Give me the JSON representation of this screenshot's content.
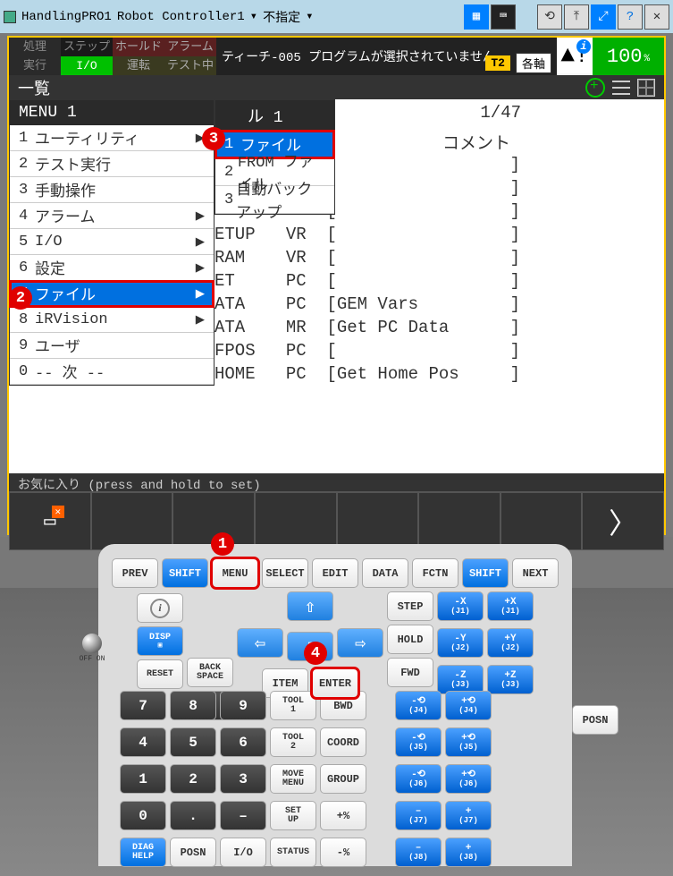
{
  "titlebar": {
    "app": "HandlingPRO1",
    "controller": "Robot Controller1",
    "mode": "不指定"
  },
  "status": {
    "row1": [
      "処理",
      "ステップ",
      "ホールド",
      "アラーム"
    ],
    "row2": [
      "実行",
      "I/O",
      "運転",
      "テスト中"
    ],
    "message": "ティーチ-005 プログラムが選択されていません",
    "t2": "T2",
    "axis": "各軸",
    "value": "100",
    "pct": "%"
  },
  "header": "一覧",
  "content": {
    "page": "1/47",
    "comment_label": "コメント",
    "bg_rows": [
      {
        "a": "",
        "b": "",
        "c": "[",
        "d": "]"
      },
      {
        "a": "",
        "b": "",
        "c": "[",
        "d": "]"
      },
      {
        "a": "",
        "b": "",
        "c": "[",
        "d": "]"
      },
      {
        "a": "ETUP",
        "b": "VR",
        "c": "[",
        "d": "]"
      },
      {
        "a": "RAM",
        "b": "VR",
        "c": "[",
        "d": "]"
      },
      {
        "a": "ET",
        "b": "PC",
        "c": "[",
        "d": "]"
      },
      {
        "a": "ATA",
        "b": "PC",
        "c": "[GEM Vars",
        "d": "]"
      },
      {
        "a": "ATA",
        "b": "MR",
        "c": "[Get PC Data",
        "d": "]"
      },
      {
        "a": "FPOS",
        "b": "PC",
        "c": "[",
        "d": "]"
      },
      {
        "a": "HOME",
        "b": "PC",
        "c": "[Get Home Pos",
        "d": "]"
      }
    ]
  },
  "menu": {
    "title": "MENU  1",
    "items": [
      {
        "n": "1",
        "label": "ユーティリティ",
        "arrow": true
      },
      {
        "n": "2",
        "label": "テスト実行",
        "arrow": false
      },
      {
        "n": "3",
        "label": "手動操作",
        "arrow": false
      },
      {
        "n": "4",
        "label": "アラーム",
        "arrow": true
      },
      {
        "n": "5",
        "label": "I/O",
        "arrow": true
      },
      {
        "n": "6",
        "label": "設定",
        "arrow": true
      },
      {
        "n": "7",
        "label": "ファイル",
        "arrow": true,
        "sel": true,
        "red": true
      },
      {
        "n": "8",
        "label": "iRVision",
        "arrow": true
      },
      {
        "n": "9",
        "label": "ユーザ",
        "arrow": false
      },
      {
        "n": "0",
        "label": "--  次  --",
        "arrow": false
      }
    ]
  },
  "submenu": {
    "title": "ル  1",
    "items": [
      {
        "n": "1",
        "label": "ファイル",
        "sel": true,
        "red": true
      },
      {
        "n": "2",
        "label": "FROM ファイル"
      },
      {
        "n": "3",
        "label": "自動バックアップ"
      }
    ]
  },
  "fav": {
    "hint": "お気に入り (press and hold to set)"
  },
  "keys": {
    "row1": [
      "PREV",
      "SHIFT",
      "MENU",
      "SELECT",
      "EDIT",
      "DATA",
      "FCTN",
      "SHIFT",
      "NEXT"
    ],
    "step": "STEP",
    "hold": "HOLD",
    "fwd": "FWD",
    "bwd": "BWD",
    "coord": "COORD",
    "group": "GROUP",
    "disp": "DISP",
    "reset": "RESET",
    "backspace": "BACK\nSPACE",
    "item": "ITEM",
    "enter": "ENTER",
    "tool1": "TOOL\n1",
    "tool2": "TOOL\n2",
    "movemenu": "MOVE\nMENU",
    "setup": "SET\nUP",
    "diag": "DIAG\nHELP",
    "posn": "POSN",
    "io": "I/O",
    "status": "STATUS",
    "posn_side": "POSN",
    "onoff": "OFF  ON",
    "nums": [
      "7",
      "8",
      "9",
      "4",
      "5",
      "6",
      "1",
      "2",
      "3",
      "0",
      ".",
      "–"
    ],
    "jogs": [
      [
        "-X",
        "(J1)",
        "+X",
        "(J1)"
      ],
      [
        "-Y",
        "(J2)",
        "+Y",
        "(J2)"
      ],
      [
        "-Z",
        "(J3)",
        "+Z",
        "(J3)"
      ],
      [
        "-⟲",
        "(J4)",
        "+⟲",
        "(J4)"
      ],
      [
        "-⟲",
        "(J5)",
        "+⟲",
        "(J5)"
      ],
      [
        "-⟲",
        "(J6)",
        "+⟲",
        "(J6)"
      ],
      [
        "–",
        "(J7)",
        "+",
        "(J7)"
      ],
      [
        "–",
        "(J8)",
        "+",
        "(J8)"
      ]
    ],
    "pctplus": "+%",
    "pctminus": "-%"
  },
  "callouts": {
    "c1": "1",
    "c2": "2",
    "c3": "3",
    "c4": "4"
  }
}
